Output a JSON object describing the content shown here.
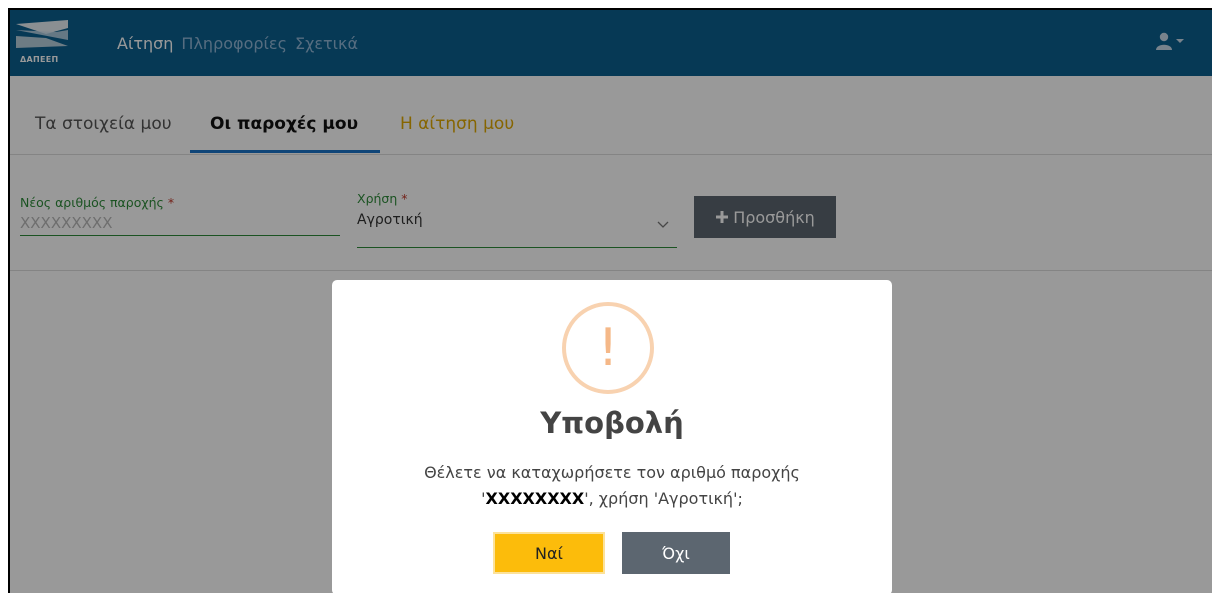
{
  "navbar": {
    "logo_text": "ΔΑΠΕΕΠ",
    "links": [
      {
        "label": "Αίτηση",
        "active": true
      },
      {
        "label": "Πληροφορίες",
        "active": false
      },
      {
        "label": "Σχετικά",
        "active": false
      }
    ],
    "user_icon": "user-icon",
    "caret_icon": "caret-down-icon"
  },
  "tabs": [
    {
      "label": "Τα στοιχεία μου"
    },
    {
      "label": "Οι παροχές μου",
      "active": true
    },
    {
      "label": "Η αίτηση μου"
    }
  ],
  "form": {
    "supply_number": {
      "label": "Νέος αριθμός παροχής",
      "required_mark": "*",
      "placeholder": "XXXXXXXXX"
    },
    "usage": {
      "label": "Χρήση",
      "required_mark": "*",
      "value": "Αγροτική"
    },
    "add_button": {
      "icon": "plus-icon",
      "label": "Προσθήκη"
    }
  },
  "modal": {
    "icon": "warning-icon",
    "icon_glyph": "!",
    "title": "Υποβολή",
    "text_line1": "Θέλετε να καταχωρήσετε τον αριθμό παροχής",
    "text_prefix": "'",
    "text_number": "XXXXXXXX",
    "text_suffix": "', χρήση 'Αγροτική';",
    "yes_label": "Ναί",
    "no_label": "Όχι"
  },
  "colors": {
    "navbar": "#0a5f8e",
    "accent_yellow": "#fcbc0b",
    "secondary_gray": "#5c6670",
    "field_green": "#2e8b3a",
    "tab_underline": "#1a73c9"
  }
}
